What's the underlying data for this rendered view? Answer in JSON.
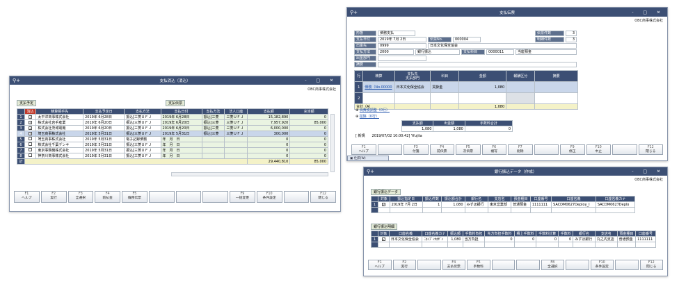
{
  "w1": {
    "title": "支払消込（消込）",
    "company": "OBC商事株式会社",
    "tab_left": "支払予定",
    "tab_right": "支払伝票",
    "left_headers": [
      "消込",
      "精算相手先",
      "支払予定日",
      "支払方法"
    ],
    "right_headers": [
      "支払日付",
      "支払方法",
      "法人口座",
      "支払額",
      "充当額"
    ],
    "rows": [
      {
        "no": "1",
        "chk": "✓",
        "partner": "太平洋商事株式会社",
        "date": "2019年 6月28日",
        "method": "振込[三菱ＵＦＪ",
        "pdate": "2019年 6月28日",
        "pmethod": "振込[三菱",
        "bank": "三菱ＵＦＪ",
        "amt": "15,182,890",
        "alloc": "0"
      },
      {
        "no": "2",
        "chk": "✓",
        "partner": "株式会社岩手産業",
        "date": "2019年 6月20日",
        "method": "振込[三菱ＵＦＪ",
        "pdate": "2019年 6月20日",
        "pmethod": "振込[三菱",
        "bank": "三菱ＵＦＪ",
        "amt": "7,957,920",
        "alloc": "85,000"
      },
      {
        "no": "3",
        "chk": "✓",
        "partner": "株式会社茨城電機",
        "date": "2019年 6月20日",
        "method": "振込[三菱ＵＦＪ",
        "pdate": "2019年 6月20日",
        "pmethod": "振込[三菱",
        "bank": "三菱ＵＦＪ",
        "amt": "6,000,000",
        "alloc": "0"
      },
      {
        "no": "4",
        "chk": "✓",
        "partner": "埼玉商事株式会社",
        "date": "2019年 5月31日",
        "method": "振込[三菱ＵＦＪ",
        "pdate": "2019年 5月31日",
        "pmethod": "振込[三菱",
        "bank": "三菱ＵＦＪ",
        "amt": "300,000",
        "alloc": "0"
      },
      {
        "no": "5",
        "chk": "",
        "partner": "埼玉商事株式会社",
        "date": "2019年 5月31日",
        "method": "電子記録債務",
        "pdate": "年　月　日",
        "pmethod": "",
        "bank": "",
        "amt": "0",
        "alloc": "0"
      },
      {
        "no": "6",
        "chk": "",
        "partner": "株式会社千葉デンキ",
        "date": "2019年 5月31日",
        "method": "振込[三菱ＵＦＪ",
        "pdate": "年　月　日",
        "pmethod": "",
        "bank": "",
        "amt": "0",
        "alloc": "0"
      },
      {
        "no": "7",
        "chk": "",
        "partner": "東京事務機株式会社",
        "date": "2019年 5月31日",
        "method": "振込[三菱ＵＦＪ",
        "pdate": "年　月　日",
        "pmethod": "",
        "bank": "",
        "amt": "0",
        "alloc": "0"
      },
      {
        "no": "8",
        "chk": "",
        "partner": "神奈川商事株式会社",
        "date": "2019年 5月31日",
        "method": "振込[三菱ＵＦＪ",
        "pdate": "年　月　日",
        "pmethod": "",
        "bank": "",
        "amt": "0",
        "alloc": "0"
      }
    ],
    "total_label": "計",
    "total_amt": "29,440,810",
    "total_alloc": "85,000",
    "fkeys": [
      {
        "k": "F1",
        "l": "ヘルプ"
      },
      {
        "k": "F2",
        "l": "実行"
      },
      {
        "k": "F3",
        "l": "全選択"
      },
      {
        "k": "F4",
        "l": "前払金"
      },
      {
        "k": "F5",
        "l": "債務伝票"
      },
      {
        "k": "",
        "l": ""
      },
      {
        "k": "",
        "l": ""
      },
      {
        "k": "",
        "l": ""
      },
      {
        "k": "F9",
        "l": "一括変更"
      },
      {
        "k": "F10",
        "l": "条件設定"
      },
      {
        "k": "",
        "l": ""
      },
      {
        "k": "F12",
        "l": "閉じる"
      }
    ]
  },
  "w2": {
    "title": "支払伝票",
    "company": "OBC商事株式会社",
    "kind_label": "形態",
    "kind_value": "債務支払",
    "date_label": "支払日付",
    "date_value": "2019年 7月 2日",
    "slip_label": "伝票No.",
    "slip_value": "000004",
    "payee_label": "出金先",
    "payee_code": "0999",
    "payee_name": "日本文化保全協会",
    "method_label": "支払方法",
    "method_code": "2000",
    "method_name": "銀行振込",
    "account_label": "支払科目",
    "account_code": "0000011",
    "account_name": "当座預金",
    "dept_label": "出金部門",
    "memo_label": "摘要",
    "count_label": "伝票件数",
    "count_value": "3",
    "line_label": "明細件数",
    "line_value": "3",
    "grid_headers": [
      "行",
      "精算",
      "支払先",
      "支払部門",
      "科目",
      "金額",
      "報酬区分",
      "摘要"
    ],
    "row1_no": "1",
    "row1_type": "債務（No.00000",
    "row1_payee": "日本文化保全協会",
    "row1_account": "買掛金",
    "row1_amount": "1,080",
    "row2_no": "2",
    "total_label": "合計（A）",
    "total_amount": "1,080",
    "tax_link": "消費税調整（0行）",
    "fee_link": "控除（0行）",
    "sum_headers": [
      "支払額",
      "出金額",
      "手数料合計"
    ],
    "sum_values": [
      "1,080",
      "1,080",
      "0"
    ],
    "status": "[ 新規　　2019/07/02 10:00:42] Yfujita",
    "taskbar": "仕訳(W)",
    "fkeys": [
      {
        "k": "F1",
        "l": "ヘルプ"
      },
      {
        "k": "",
        "l": ""
      },
      {
        "k": "F3",
        "l": "付箋"
      },
      {
        "k": "F4",
        "l": "前伝票"
      },
      {
        "k": "F5",
        "l": "次伝票"
      },
      {
        "k": "F6",
        "l": "複写"
      },
      {
        "k": "F7",
        "l": "削除"
      },
      {
        "k": "",
        "l": ""
      },
      {
        "k": "F9",
        "l": "修正"
      },
      {
        "k": "F10",
        "l": "中止"
      },
      {
        "k": "",
        "l": ""
      },
      {
        "k": "F12",
        "l": "閉じる"
      }
    ]
  },
  "w3": {
    "title": "銀行振込データ（作成）",
    "company": "OBC商事株式会社",
    "section1": "銀行振込データ",
    "headers1": [
      "対象",
      "振込指定日",
      "振込件数",
      "振込額合計",
      "銀行名",
      "支店名",
      "預金種目",
      "口座番号",
      "口座名義",
      "口座名義カナ"
    ],
    "row1": {
      "no": "1",
      "chk": "✓",
      "date": "2019年 7月 2日",
      "count": "1",
      "total": "1,080",
      "bank": "みずほ銀行",
      "branch": "東京営業部",
      "type": "普通預金",
      "acct": "1111111",
      "holder": "SACDM0627Deploy_I",
      "kana": "SACDM0627Deplo"
    },
    "section2": "銀行振込明細",
    "headers2": [
      "対象",
      "口座名義",
      "口座名義カナ",
      "振込額",
      "手数料負担",
      "先方負担手数料",
      "積上手数料",
      "手数料計算",
      "手数料",
      "銀行名",
      "支店名",
      "預金種目",
      "口座番号"
    ],
    "row2": {
      "no": "1",
      "chk": "✓",
      "holder": "日本文化保全協会",
      "kana": "ﾆﾎﾝﾌﾞﾝｶﾎｾﾞﾝ",
      "amount": "1,080",
      "burden": "当方負担",
      "c1": "0",
      "c2": "0",
      "c3": "0",
      "fee": "0",
      "bank": "みずほ銀行",
      "branch": "丸之内支店",
      "type": "普通預金",
      "acct": "1111111"
    },
    "fkeys": [
      {
        "k": "F1",
        "l": "ヘルプ"
      },
      {
        "k": "F2",
        "l": "実行"
      },
      {
        "k": "",
        "l": ""
      },
      {
        "k": "F4",
        "l": "支払伝票"
      },
      {
        "k": "F5",
        "l": "手数料"
      },
      {
        "k": "",
        "l": ""
      },
      {
        "k": "",
        "l": ""
      },
      {
        "k": "F8",
        "l": "全選択"
      },
      {
        "k": "",
        "l": ""
      },
      {
        "k": "F10",
        "l": "条件設定"
      },
      {
        "k": "",
        "l": ""
      },
      {
        "k": "F12",
        "l": "閉じる"
      }
    ]
  }
}
